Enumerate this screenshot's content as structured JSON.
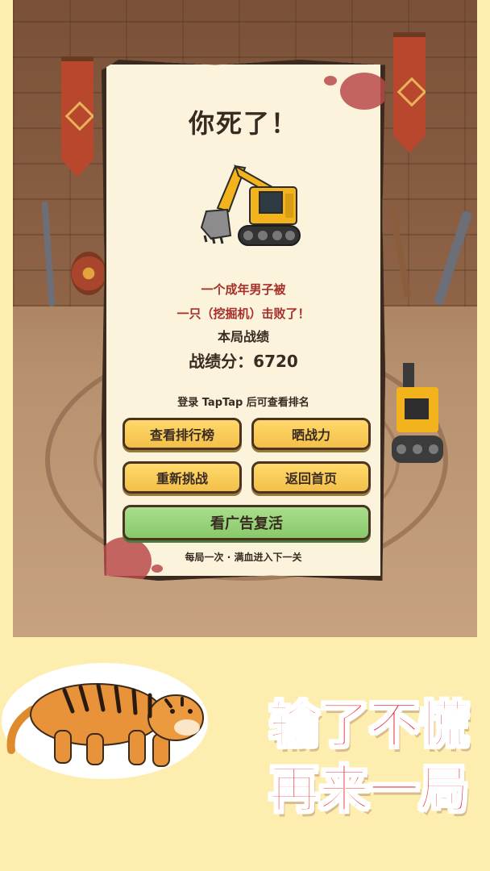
{
  "dialog": {
    "title": "你死了！",
    "killer_icon": "excavator-icon",
    "message_line1": "一个成年男子被",
    "message_line2": "一只（挖掘机）击败了！",
    "record_heading": "本局战绩",
    "score_label": "战绩分：",
    "score_value": "6720",
    "login_hint": "登录 TapTap 后可查看排名",
    "buttons": {
      "leaderboard": "查看排行榜",
      "share_power": "晒战力",
      "retry": "重新挑战",
      "home": "返回首页",
      "watch_ad_revive": "看广告复活"
    },
    "note": "每局一次 · 满血进入下一关"
  },
  "promo": {
    "tiger_icon": "tiger-icon",
    "slogan_line1": "输了不慌",
    "slogan_line2": "再来一局"
  },
  "colors": {
    "page_bg": "#fdeeb0",
    "parchment": "#fbf3dc",
    "button_yellow": "#f3c04a",
    "button_green": "#88c96a",
    "message_red": "#a5302a",
    "slogan_red": "#e7343f"
  }
}
